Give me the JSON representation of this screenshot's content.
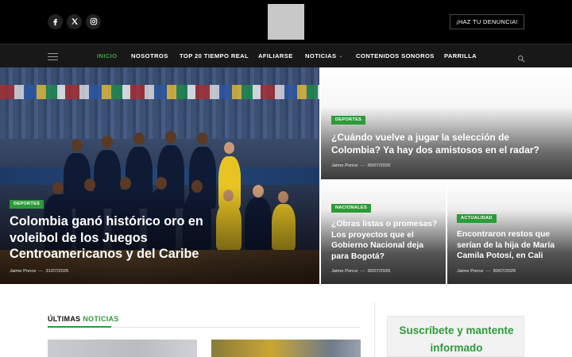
{
  "header": {
    "social": [
      {
        "name": "facebook",
        "glyph": "f"
      },
      {
        "name": "x-twitter",
        "glyph": "𝕏"
      },
      {
        "name": "instagram",
        "glyph": ""
      }
    ],
    "report_button": "¡HAZ TU DENUNCIA!"
  },
  "nav": {
    "items": [
      "INICIO",
      "NOSOTROS",
      "TOP 20 TIEMPO REAL",
      "AFILIARSE",
      "NOTICIAS",
      "CONTENIDOS SONOROS",
      "PARRILLA"
    ],
    "active": "INICIO"
  },
  "featured": [
    {
      "category": "DEPORTES",
      "title": "Colombia ganó histórico oro en voleibol de los Juegos Centroamericanos y del Caribe",
      "author": "Jaime Ponce",
      "date": "31/07/2026"
    },
    {
      "category": "DEPORTES",
      "title": "¿Cuándo vuelve a jugar la selección de Colombia? Ya hay dos amistosos en el radar?",
      "author": "Jaime Ponce",
      "date": "30/07/2026"
    },
    {
      "category": "NACIONALES",
      "title": "¿Obras listas o promesas? Los proyectos que el Gobierno Nacional deja para Bogotá?",
      "author": "Jaime Ponce",
      "date": "30/07/2026"
    },
    {
      "category": "ACTUALIDAD",
      "title": "Encontraron restos que serían de la hija de María Camila Potosí, en Cali",
      "author": "Jaime Ponce",
      "date": "30/07/2026"
    }
  ],
  "latest": {
    "title_part1": "ÚLTIMAS",
    "title_part2": "NOTICIAS"
  },
  "subscribe": {
    "line1": "Suscríbete y mantente",
    "line2": "informado"
  },
  "colors": {
    "accent": "#2e9a3a",
    "topbar": "#000000",
    "nav": "#181818"
  }
}
